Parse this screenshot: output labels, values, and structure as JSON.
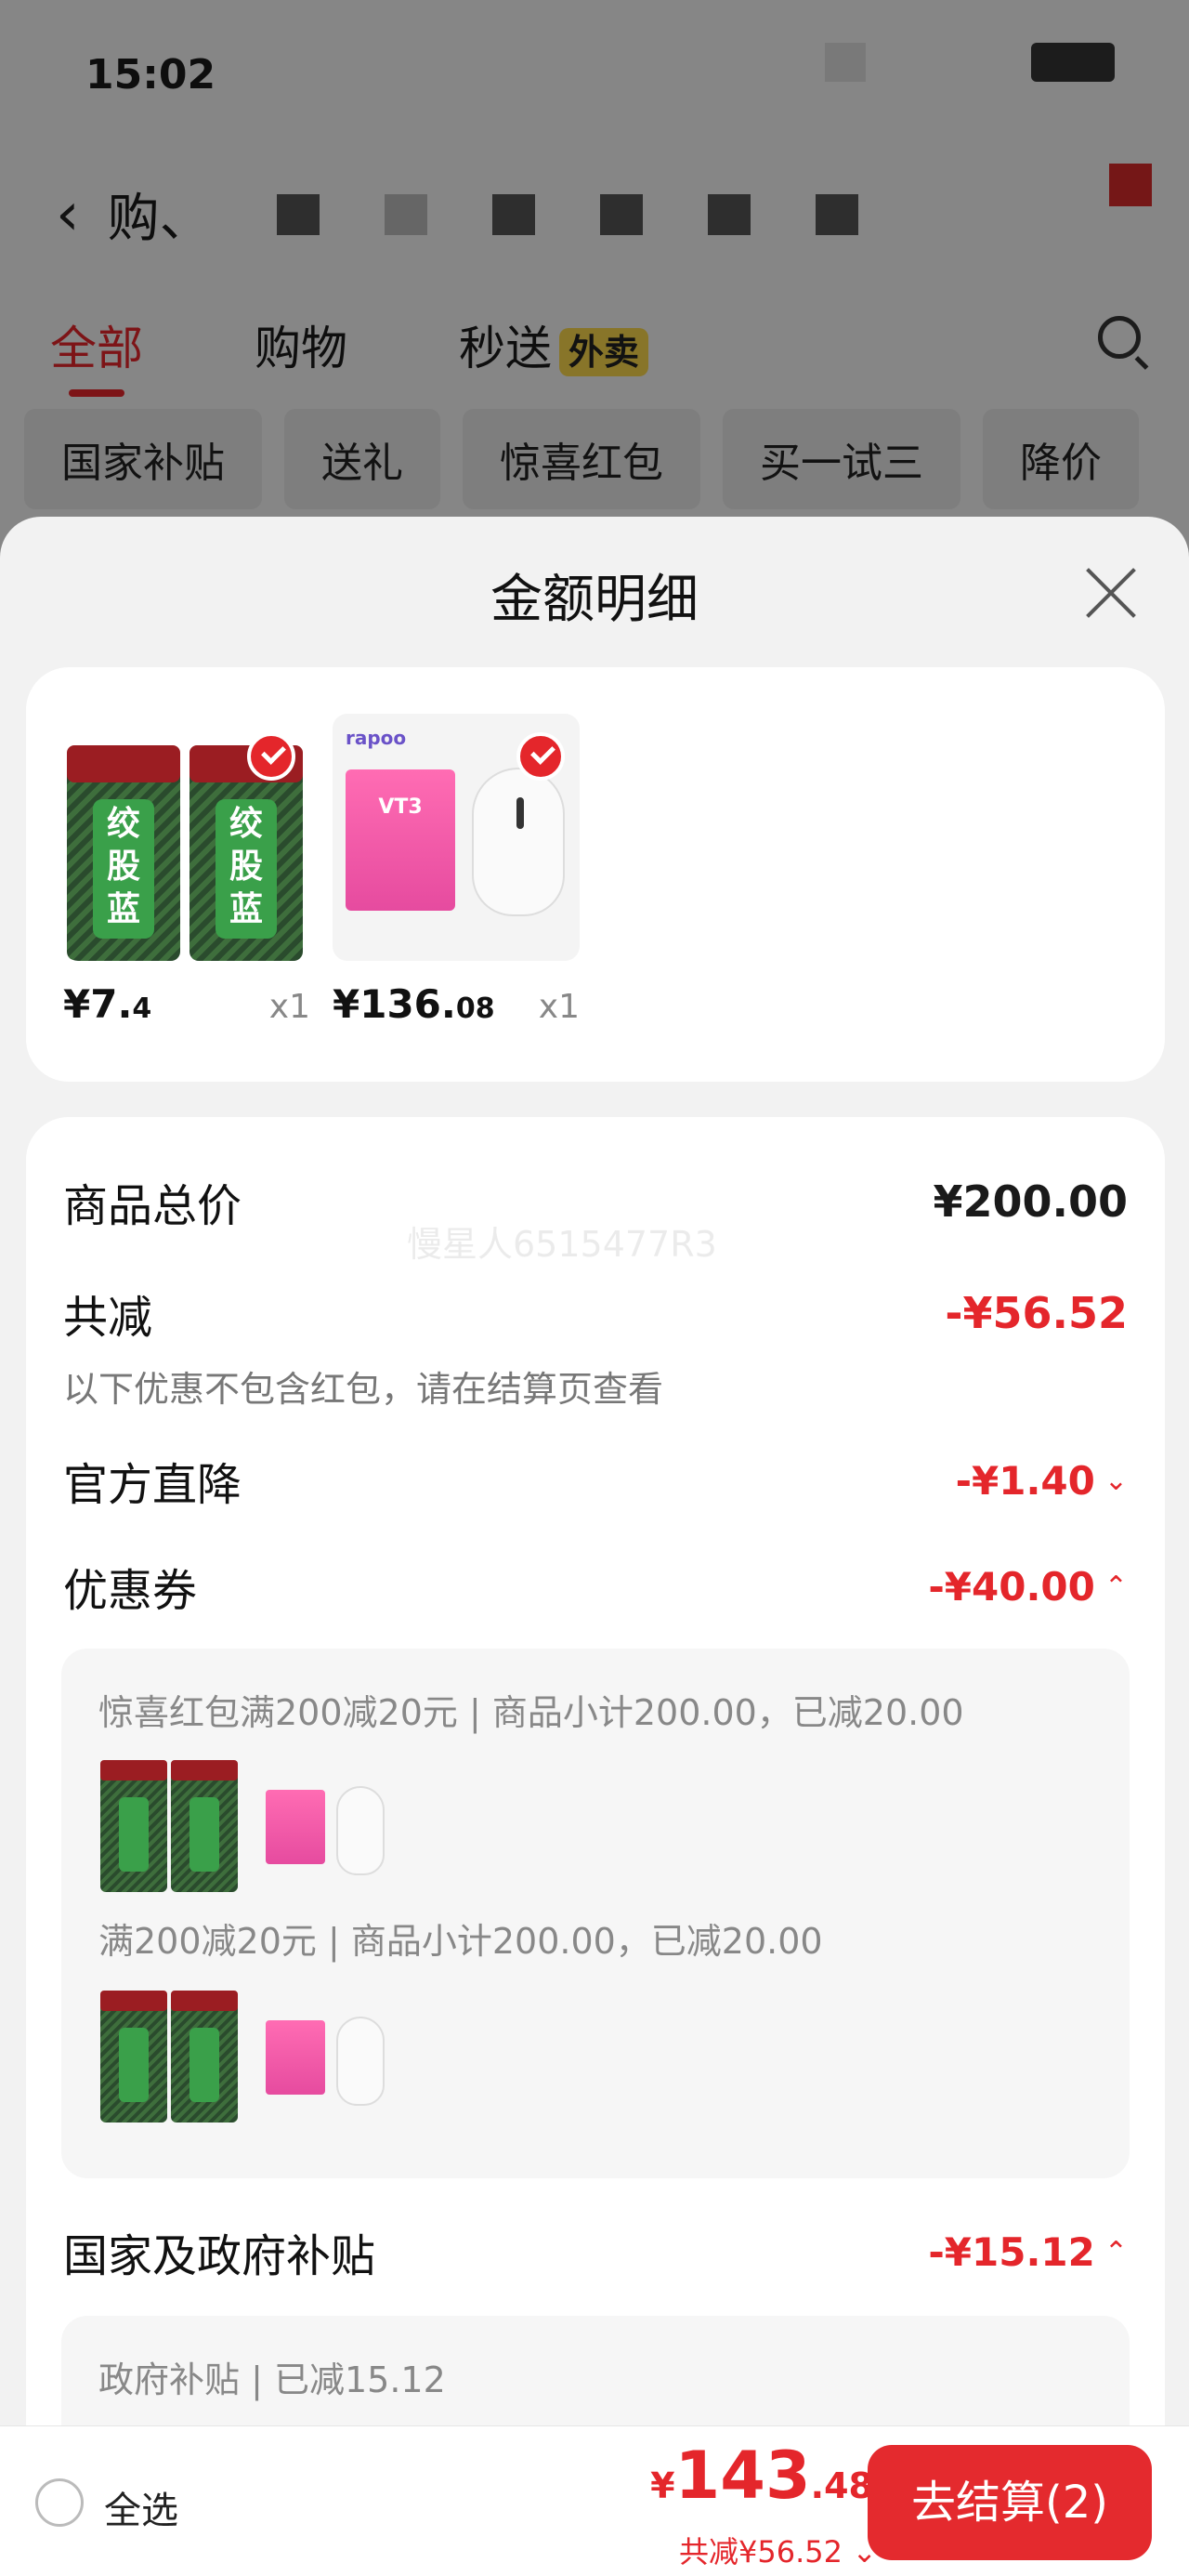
{
  "status": {
    "time": "15:02"
  },
  "header": {
    "title": "购、"
  },
  "tabs": [
    {
      "label": "全部"
    },
    {
      "label": "购物"
    },
    {
      "label": "秒送",
      "badge": "外卖"
    }
  ],
  "chips": [
    "国家补贴",
    "送礼",
    "惊喜红包",
    "买一试三",
    "降价"
  ],
  "sheet": {
    "title": "金额明细",
    "products": [
      {
        "price_main": "¥7.",
        "price_dec": "4",
        "qty": "x1",
        "jar_text": "绞\n股\n蓝"
      },
      {
        "price_main": "¥136.",
        "price_dec": "08",
        "qty": "x1",
        "brand": "rapoo",
        "box_text": "VT3"
      }
    ],
    "watermark": "慢星人6515477R3",
    "summary": {
      "subtotal_label": "商品总价",
      "subtotal_value": "¥200.00",
      "discount_label": "共减",
      "discount_value": "-¥56.52",
      "note": "以下优惠不包含红包，请在结算页查看",
      "official_label": "官方直降",
      "official_value": "-¥1.40",
      "coupon_label": "优惠券",
      "coupon_value": "-¥40.00",
      "coupon_lines": [
        "惊喜红包满200减20元 | 商品小计200.00，已减20.00",
        "满200减20元 | 商品小计200.00，已减20.00"
      ],
      "subsidy_label": "国家及政府补贴",
      "subsidy_value": "-¥15.12",
      "subsidy_line": "政府补贴 | 已减15.12"
    }
  },
  "bottom": {
    "select_all": "全选",
    "total_currency": "¥",
    "total_int": "143",
    "total_dec": ".48",
    "total_sub": "共减¥56.52",
    "checkout": "去结算(2)"
  },
  "colors": {
    "accent": "#e4262b",
    "sheet_bg": "#f2f2f2"
  }
}
